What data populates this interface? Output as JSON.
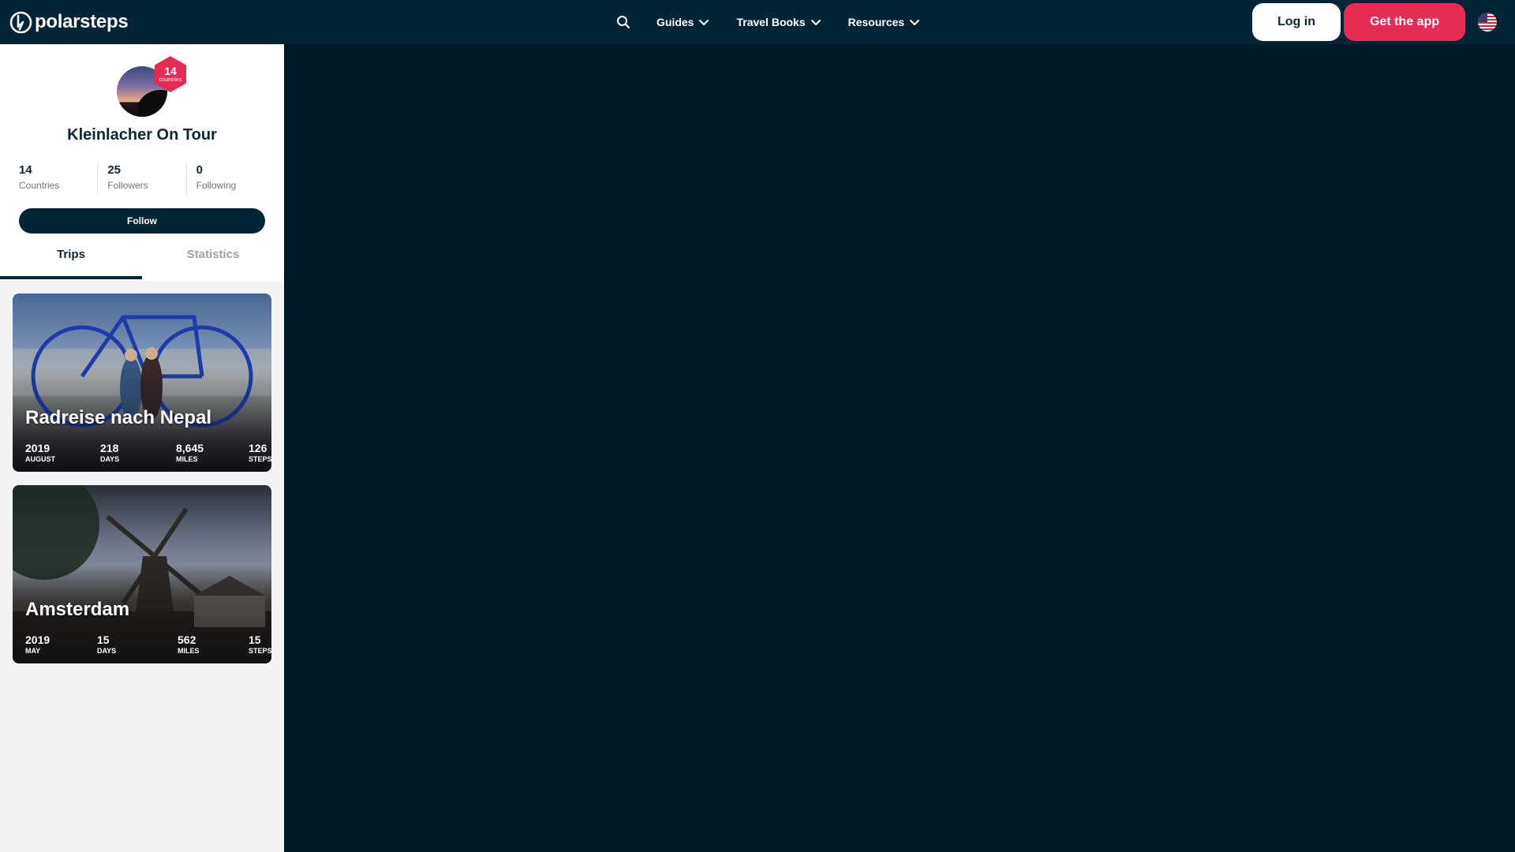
{
  "navbar": {
    "logo_text": "polarsteps",
    "menu": [
      {
        "label": "Guides"
      },
      {
        "label": "Travel Books"
      },
      {
        "label": "Resources"
      }
    ],
    "login_label": "Log in",
    "getapp_label": "Get the app",
    "colors": {
      "bar": "#002635",
      "accent": "#e62c55"
    }
  },
  "profile": {
    "name": "Kleinlacher On Tour",
    "badge_count": "14",
    "badge_label": "countries",
    "stats": [
      {
        "value": "14",
        "label": "Countries"
      },
      {
        "value": "25",
        "label": "Followers"
      },
      {
        "value": "0",
        "label": "Following"
      }
    ],
    "follow_label": "Follow",
    "tabs": [
      {
        "label": "Trips",
        "active": true
      },
      {
        "label": "Statistics",
        "active": false
      }
    ]
  },
  "trips": [
    {
      "title": "Radreise nach Nepal",
      "year": "2019",
      "month": "AUGUST",
      "days": "218",
      "days_label": "DAYS",
      "miles": "8,645",
      "miles_label": "MILES",
      "steps": "126",
      "steps_label": "STEPS"
    },
    {
      "title": "Amsterdam",
      "year": "2019",
      "month": "MAY",
      "days": "15",
      "days_label": "DAYS",
      "miles": "562",
      "miles_label": "MILES",
      "steps": "15",
      "steps_label": "STEPS"
    }
  ]
}
